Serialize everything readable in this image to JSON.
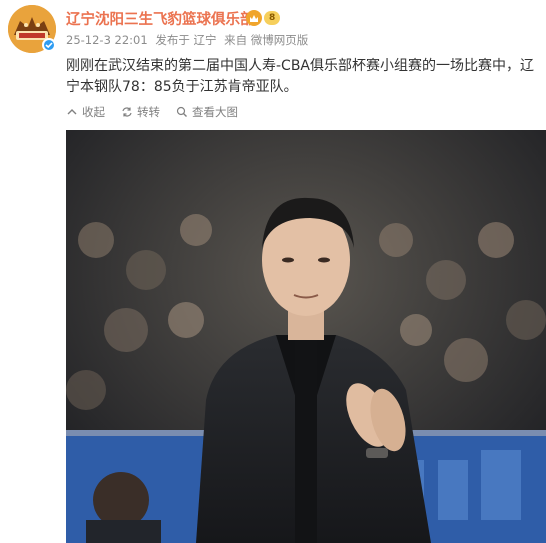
{
  "post": {
    "username": "辽宁沈阳三生飞豹篮球俱乐部",
    "level_badge": "8",
    "meta": {
      "time": "25-12-3 22:01",
      "published_in": "发布于 辽宁",
      "source": "来自 微博网页版"
    },
    "content": "刚刚在武汉结束的第二届中国人寿-CBA俱乐部杯赛小组赛的一场比赛中，辽宁本钢队78：85负于江苏肯帝亚队。",
    "actions": {
      "collapse": "收起",
      "repost": "转转",
      "view_large": "查看大图"
    }
  },
  "icons": {
    "avatar": "flying-leopards-logo",
    "verified": "verified-check-icon",
    "crown": "crown-icon",
    "collapse": "collapse-arrow-icon",
    "repost": "repost-icon",
    "view_large": "magnify-icon"
  },
  "colors": {
    "username": "#eb7350",
    "meta": "#8c8c8c",
    "content": "#333333",
    "verified": "#2e9cf2",
    "badge": "#f6cf5c"
  }
}
